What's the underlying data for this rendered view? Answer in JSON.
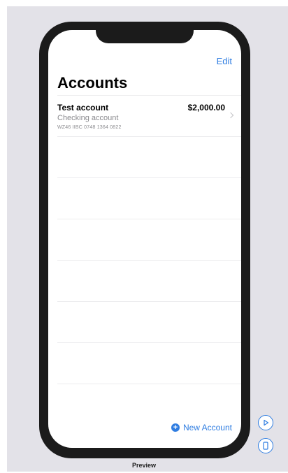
{
  "header": {
    "edit_label": "Edit",
    "title": "Accounts"
  },
  "accounts": [
    {
      "name": "Test account",
      "type": "Checking account",
      "iban": "WZ46 IIBC 0748 1364 0822",
      "balance": "$2,000.00"
    }
  ],
  "footer": {
    "new_account_label": "New Account"
  },
  "preview": {
    "label": "Preview"
  },
  "colors": {
    "accent": "#2f7de1",
    "canvas": "#e3e2e8",
    "device": "#1b1b1b"
  },
  "icons": {
    "add": "plus-circle-icon",
    "play": "play-circle-icon",
    "device": "device-icon",
    "chevron": "chevron-right-icon"
  }
}
